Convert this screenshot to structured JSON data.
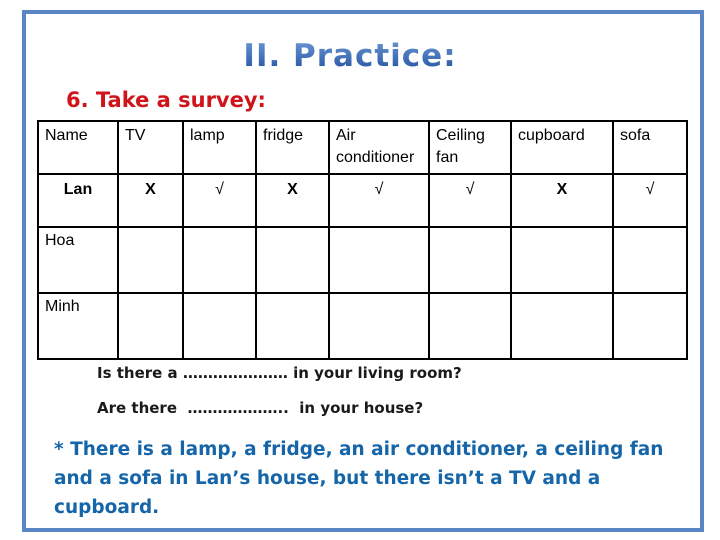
{
  "slide": {
    "title": "II. Practice:",
    "subtitle": "6. Take a survey:"
  },
  "survey_table": {
    "headers": [
      {
        "line1": "Name",
        "line2": ""
      },
      {
        "line1": "TV",
        "line2": ""
      },
      {
        "line1": "lamp",
        "line2": ""
      },
      {
        "line1": "fridge",
        "line2": ""
      },
      {
        "line1": "Air",
        "line2": "conditioner"
      },
      {
        "line1": "Ceiling",
        "line2": "fan"
      },
      {
        "line1": "cupboard",
        "line2": ""
      },
      {
        "line1": "sofa",
        "line2": ""
      }
    ],
    "rows": [
      {
        "name": "Lan",
        "values": [
          "X",
          "√",
          "X",
          "√",
          "√",
          "X",
          "√"
        ]
      },
      {
        "name": "Hoa",
        "values": [
          "",
          "",
          "",
          "",
          "",
          "",
          ""
        ]
      },
      {
        "name": "Minh",
        "values": [
          "",
          "",
          "",
          "",
          "",
          "",
          ""
        ]
      }
    ]
  },
  "questions": {
    "q1": "Is there a ………………… in your living room?",
    "q2": "Are there  ………………..  in your house?"
  },
  "note": {
    "line1": "* There is a lamp, a fridge, an air conditioner, a ceiling fan",
    "line2": "and a sofa in Lan’s house, but there isn’t a TV and a cupboard."
  },
  "colors": {
    "frame": "#5b86c5",
    "title": "#2d5fae",
    "subtitle": "#d0141b",
    "note": "#1565a8"
  }
}
